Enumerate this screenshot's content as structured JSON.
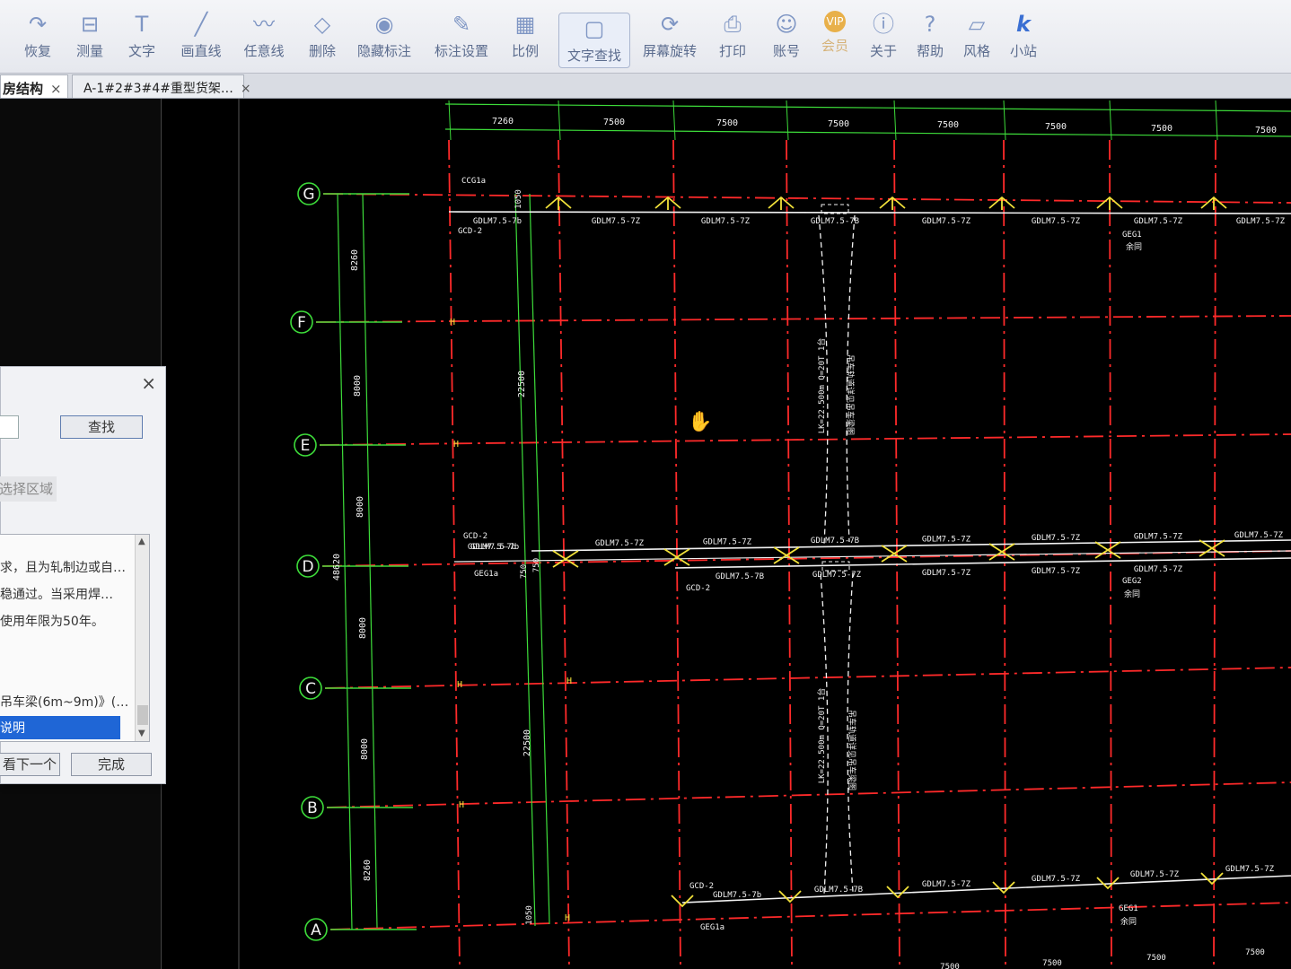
{
  "toolbar": {
    "items": [
      {
        "label": "恢复",
        "icon": "redo-icon"
      },
      {
        "label": "测量",
        "icon": "measure-icon"
      },
      {
        "label": "文字",
        "icon": "text-icon"
      },
      {
        "label": "画直线",
        "icon": "line-icon"
      },
      {
        "label": "任意线",
        "icon": "freehand-icon"
      },
      {
        "label": "删除",
        "icon": "eraser-icon"
      },
      {
        "label": "隐藏标注",
        "icon": "eye-hide-icon"
      },
      {
        "label": "标注设置",
        "icon": "pen-settings-icon"
      },
      {
        "label": "比例",
        "icon": "scale-icon"
      },
      {
        "label": "文字查找",
        "icon": "text-search-icon"
      },
      {
        "label": "屏幕旋转",
        "icon": "screen-rotate-icon"
      },
      {
        "label": "打印",
        "icon": "printer-icon"
      },
      {
        "label": "账号",
        "icon": "user-icon"
      },
      {
        "label": "会员",
        "icon": "vip-icon",
        "badge": "VIP"
      },
      {
        "label": "关于",
        "icon": "info-icon"
      },
      {
        "label": "帮助",
        "icon": "help-icon"
      },
      {
        "label": "风格",
        "icon": "style-icon"
      },
      {
        "label": "小站",
        "icon": "k-brand-icon",
        "badge": "k"
      }
    ]
  },
  "tabs": [
    {
      "label": "房结构",
      "close": "×"
    },
    {
      "label": "A-1#2#3#4#重型货架…",
      "close": "×"
    }
  ],
  "find_dialog": {
    "close": "×",
    "find_button": "查找",
    "select_area": "选择区域",
    "results": [
      "求，且为轧制边或自…",
      "稳通过。当采用焊…",
      "使用年限为50年。",
      "吊车梁(6m~9m)》(…",
      "说明"
    ],
    "next_button": "看下一个",
    "done_button": "完成"
  },
  "drawing": {
    "colors": {
      "axis_green": "#3ddc3a",
      "grid_red": "#ff2a2a",
      "white": "#f2f2f2",
      "yellow": "#f2e23a",
      "bg": "#000000"
    },
    "grid_labels": [
      "G",
      "F",
      "E",
      "D",
      "C",
      "B",
      "A"
    ],
    "top_dims": [
      "7260",
      "7500",
      "7500",
      "7500",
      "7500",
      "7500",
      "7500",
      "7500"
    ],
    "left_dims_outer": [
      "8260",
      "8000",
      "8000",
      "48620",
      "8000",
      "8000",
      "8260"
    ],
    "left_dims_inner": [
      "22500",
      "22500"
    ],
    "small_dims": [
      "1050",
      "750",
      "750",
      "1050"
    ],
    "beam_labels_g": [
      "GDLM7.5-7b",
      "GDLM7.5-7Z",
      "GDLM7.5-7Z",
      "GDLM7.5-7B",
      "GDLM7.5-7Z",
      "GDLM7.5-7Z",
      "GDLM7.5-7Z",
      "GDLM7.5-7Z"
    ],
    "beam_labels_d_top": [
      "GDLM7.5-7Z",
      "GDLM7.5-7Z",
      "GDLM7.5-7B",
      "GDLM7.5-7Z",
      "GDLM7.5-7Z",
      "GDLM7.5-7Z",
      "GDLM7.5-7Z"
    ],
    "beam_labels_d_bottom": [
      "GDLM7.5-7b",
      "GDLM7.5-7B",
      "GDLM7.5-7Z",
      "GDLM7.5-7Z",
      "GDLM7.5-7Z",
      "GDLM7.5-7Z"
    ],
    "beam_labels_a": [
      "GDLM7.5-7B",
      "GDLM7.5-7Z",
      "GDLM7.5-7Z",
      "GDLM7.5-7Z",
      "GDLM7.5-7Z"
    ],
    "tags": {
      "cc": "CCG1a",
      "gcd2": "GCD-2",
      "gcd2_d": "GCD-2",
      "gdlm_d": "GDLM7.5-7b",
      "gdlm_a": "GDLM7.5-7b",
      "gcd2_bottom": "GCD-2",
      "gcd2_a": "GCD-2",
      "geg1a": "GEG1a",
      "geg1a_a": "GEG1a",
      "geg1_g": "GEG1",
      "geg2_d": "GEG2",
      "geg1_a": "GEG1",
      "yu": "余同",
      "yu_d": "余同",
      "yu_a": "余同"
    },
    "crane_label": "LK=22.500m Q=20T 1台",
    "crane_note": "吊车轨道详见吊车梁图",
    "bottom_dims": [
      "7500",
      "7500",
      "7500",
      "7500"
    ]
  }
}
